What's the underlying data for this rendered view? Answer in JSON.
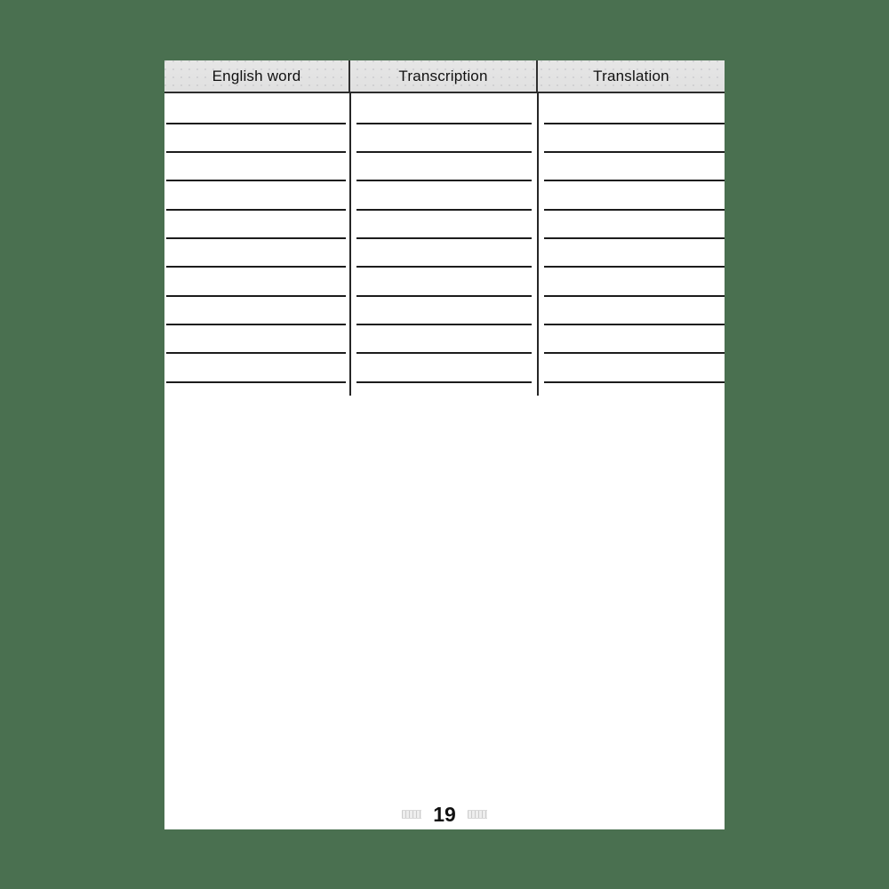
{
  "canvas": {
    "background_color": "#4a7050",
    "page_color": "#ffffff"
  },
  "page": {
    "number": "19",
    "footer_ornament_left": "decorative-dashed-bar",
    "footer_ornament_right": "decorative-dashed-bar"
  },
  "table": {
    "columns": [
      {
        "key": "english_word",
        "label": "English word"
      },
      {
        "key": "transcription",
        "label": "Transcription"
      },
      {
        "key": "translation",
        "label": "Translation"
      }
    ],
    "header_background": "#e3e3e3",
    "rule_color": "#1c1c1c",
    "row_count": 10,
    "rows": [
      {
        "english_word": "",
        "transcription": "",
        "translation": ""
      },
      {
        "english_word": "",
        "transcription": "",
        "translation": ""
      },
      {
        "english_word": "",
        "transcription": "",
        "translation": ""
      },
      {
        "english_word": "",
        "transcription": "",
        "translation": ""
      },
      {
        "english_word": "",
        "transcription": "",
        "translation": ""
      },
      {
        "english_word": "",
        "transcription": "",
        "translation": ""
      },
      {
        "english_word": "",
        "transcription": "",
        "translation": ""
      },
      {
        "english_word": "",
        "transcription": "",
        "translation": ""
      },
      {
        "english_word": "",
        "transcription": "",
        "translation": ""
      },
      {
        "english_word": "",
        "transcription": "",
        "translation": ""
      }
    ],
    "line_offsets": [
      33,
      65,
      97,
      130,
      162,
      194,
      227,
      259,
      291,
      324
    ]
  }
}
